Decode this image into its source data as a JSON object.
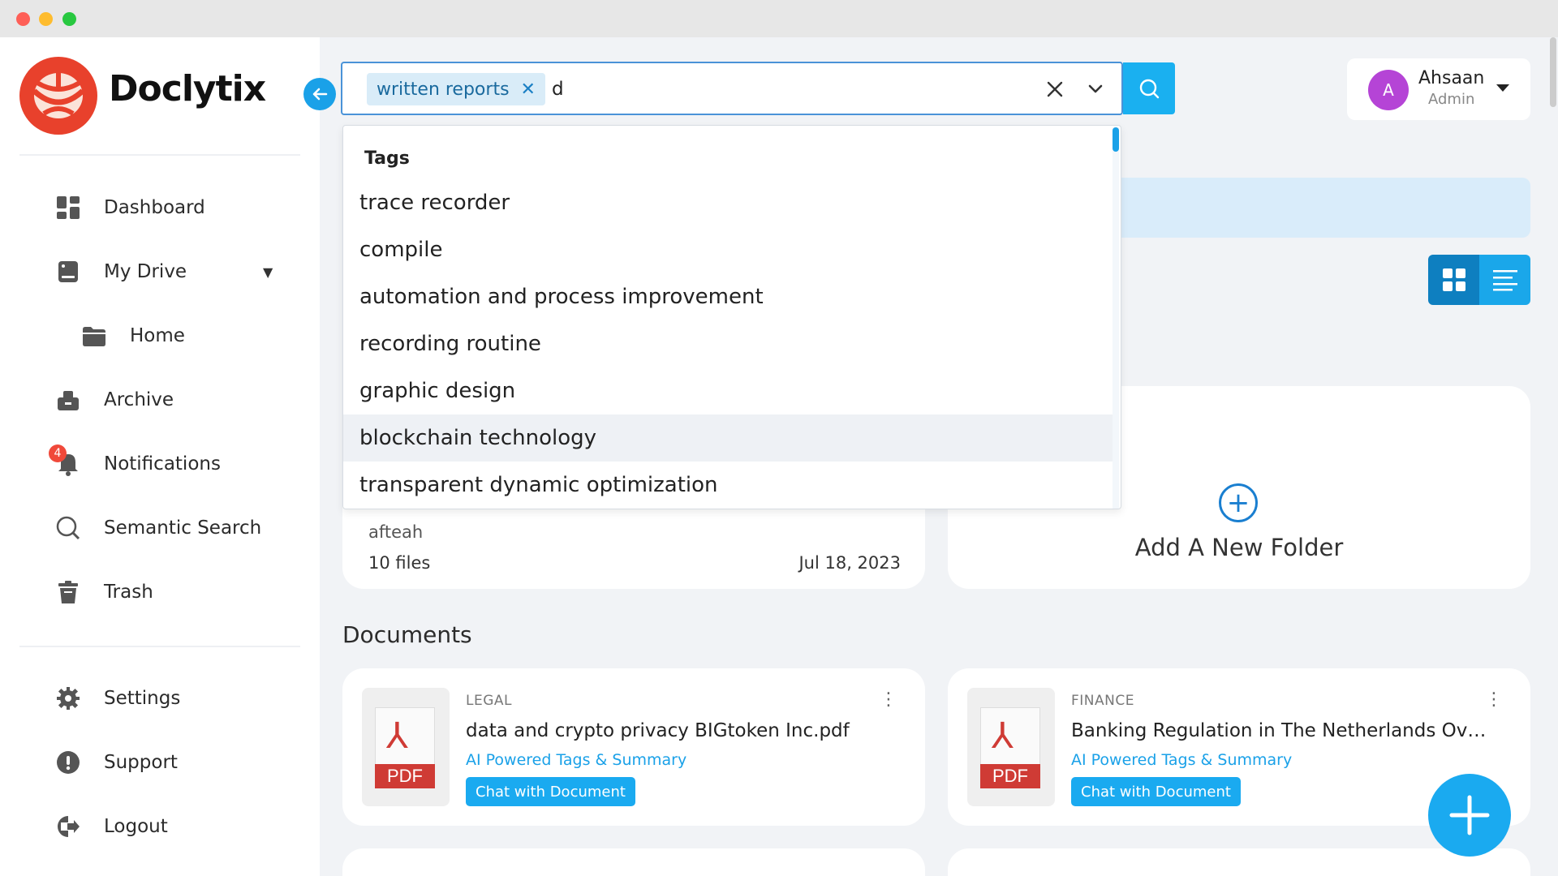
{
  "app": {
    "name": "Doclytix"
  },
  "sidebar": {
    "items": [
      {
        "label": "Dashboard"
      },
      {
        "label": "My Drive"
      },
      {
        "label": "Home"
      },
      {
        "label": "Archive"
      },
      {
        "label": "Notifications",
        "badge": "4"
      },
      {
        "label": "Semantic Search"
      },
      {
        "label": "Trash"
      },
      {
        "label": "Settings"
      },
      {
        "label": "Support"
      },
      {
        "label": "Logout"
      }
    ]
  },
  "search": {
    "chip_label": "written reports",
    "value": "d",
    "placeholder": ""
  },
  "user": {
    "initial": "A",
    "name": "Ahsaan",
    "role": "Admin"
  },
  "dropdown": {
    "header": "Tags",
    "options": [
      "trace recorder",
      "compile",
      "automation and process improvement",
      "recording routine",
      "graphic design",
      "blockchain technology",
      "transparent dynamic optimization"
    ],
    "highlighted_index": 5
  },
  "folder": {
    "name_partial": "afteah",
    "files": "10 files",
    "date": "Jul 18, 2023"
  },
  "add_folder": {
    "label": "Add A New Folder"
  },
  "documents": {
    "title": "Documents",
    "items": [
      {
        "category": "LEGAL",
        "title": "data and crypto privacy BIGtoken Inc.pdf",
        "tags_link": "AI Powered Tags & Summary",
        "chat_button": "Chat with Document",
        "file_type": "PDF"
      },
      {
        "category": "FINANCE",
        "title": "Banking Regulation in The Netherlands Overvie...",
        "tags_link": "AI Powered Tags & Summary",
        "chat_button": "Chat with Document",
        "file_type": "PDF"
      }
    ]
  },
  "colors": {
    "accent": "#1aaaf0",
    "logo": "#e8412c",
    "badge": "#f0493a",
    "avatar": "#b544d6"
  }
}
